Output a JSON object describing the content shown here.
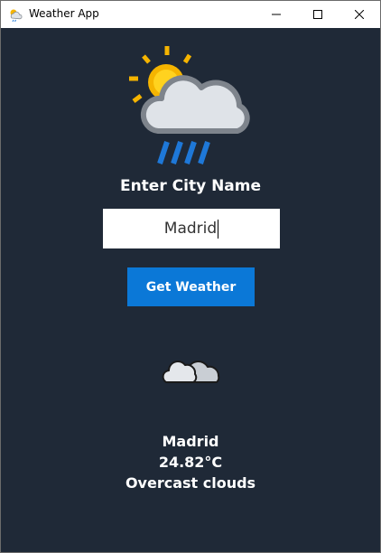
{
  "window": {
    "title": "Weather App",
    "app_icon": "weather-app-icon",
    "controls": {
      "minimize_icon": "minimize-icon",
      "maximize_icon": "maximize-icon",
      "close_icon": "close-icon"
    }
  },
  "main": {
    "hero_icon": "sun-cloud-rain-icon",
    "prompt": "Enter City Name",
    "city_input": {
      "value": "Madrid"
    },
    "get_weather_label": "Get Weather",
    "result": {
      "icon": "overcast-clouds-icon",
      "city": "Madrid",
      "temperature": "24.82°C",
      "description": "Overcast clouds"
    }
  },
  "colors": {
    "background": "#1f2937",
    "button": "#0b78d7",
    "text": "#ffffff",
    "sun": "#f5b400",
    "rain": "#1e78d8"
  }
}
